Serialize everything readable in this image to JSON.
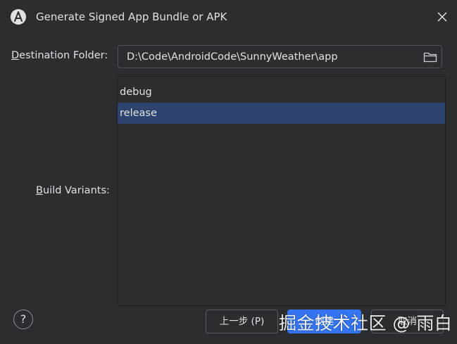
{
  "window": {
    "title": "Generate Signed App Bundle or APK",
    "app_icon": "android-studio-icon",
    "close_icon": "close-icon"
  },
  "destination": {
    "label_mnemonic": "D",
    "label_rest": "estination Folder:",
    "value": "D:\\Code\\AndroidCode\\SunnyWeather\\app",
    "browse_icon": "folder-icon"
  },
  "build_variants": {
    "label_mnemonic": "B",
    "label_rest": "uild Variants:",
    "items": [
      {
        "label": "debug",
        "selected": false
      },
      {
        "label": "release",
        "selected": true
      }
    ]
  },
  "footer": {
    "help_label": "?",
    "prev_label": "上一步 (P)",
    "next_label": "创建",
    "cancel_label": "取消"
  },
  "watermark": "掘金技术社区 @ 雨白",
  "colors": {
    "background": "#2b2d30",
    "selection": "#2e436e",
    "primary_button": "#3574f0",
    "text": "#dfe1e5"
  }
}
